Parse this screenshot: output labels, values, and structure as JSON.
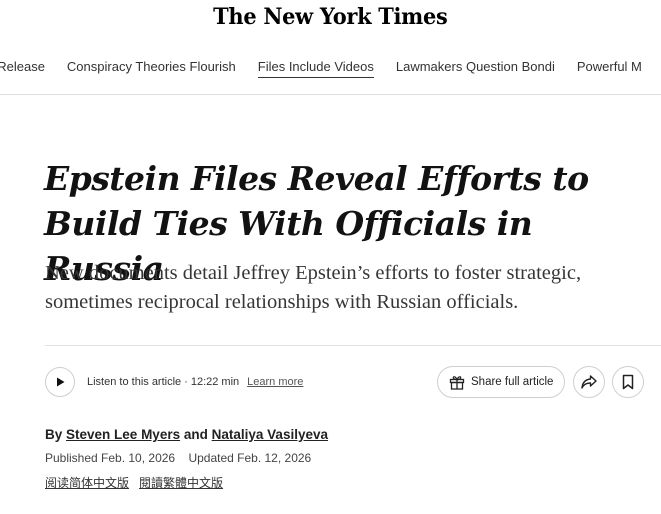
{
  "masthead": {
    "logo_text": "The New York Times"
  },
  "nav": {
    "items": [
      {
        "label": "t Release"
      },
      {
        "label": "Conspiracy Theories Flourish"
      },
      {
        "label": "Files Include Videos",
        "active": true
      },
      {
        "label": "Lawmakers Question Bondi"
      },
      {
        "label": "Powerful M"
      }
    ]
  },
  "article": {
    "headline": "Epstein Files Reveal Efforts to Build Ties With Officials in Russia",
    "summary": "New documents detail Jeffrey Epstein’s efforts to foster strategic, sometimes reciprocal relationships with Russian officials."
  },
  "toolbar": {
    "listen_label": "Listen to this article",
    "separator": "·",
    "duration": "12:22 min",
    "learn_more": "Learn more",
    "share_label": "Share full article",
    "icons": {
      "play": "play-icon",
      "gift": "gift-icon",
      "share": "share-arrow-icon",
      "bookmark": "bookmark-icon"
    }
  },
  "byline": {
    "prefix": "By",
    "author1": "Steven Lee Myers",
    "conjunction": "and",
    "author2": "Nataliya Vasilyeva"
  },
  "dates": {
    "published": "Published Feb. 10, 2026",
    "updated": "Updated Feb. 12, 2026"
  },
  "languages": {
    "simplified": "阅读简体中文版",
    "traditional": "閱讀繁體中文版"
  }
}
